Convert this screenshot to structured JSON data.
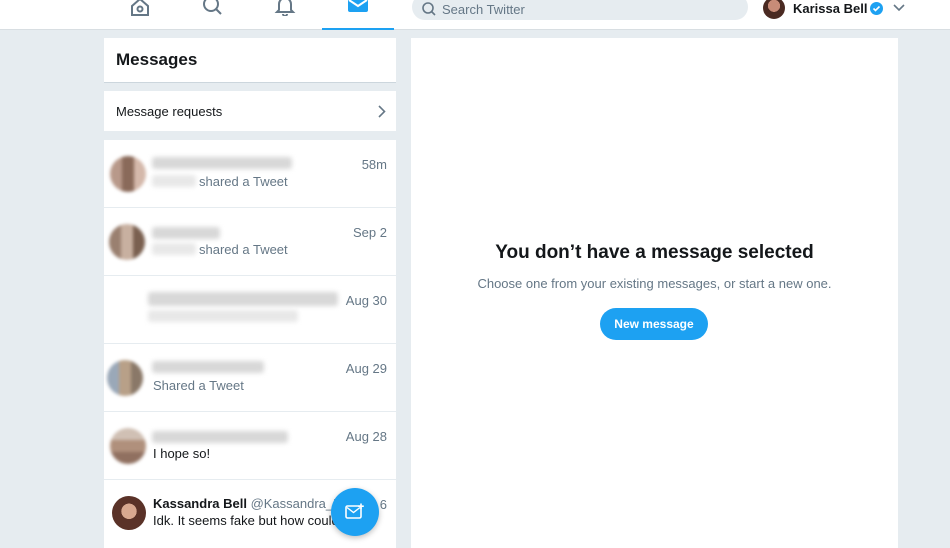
{
  "nav": {
    "icons": [
      "home-icon",
      "search-icon",
      "notifications-icon",
      "messages-icon"
    ],
    "active": "messages-icon",
    "search_placeholder": "Search Twitter"
  },
  "user": {
    "name": "Karissa Bell",
    "verified": true
  },
  "messages": {
    "title": "Messages",
    "requests_label": "Message requests",
    "conversations": [
      {
        "snippet": "shared a Tweet",
        "time": "58m"
      },
      {
        "snippet": "shared a Tweet",
        "time": "Sep 2"
      },
      {
        "snippet": "",
        "time": "Aug 30"
      },
      {
        "snippet": "Shared a Tweet",
        "time": "Aug 29"
      },
      {
        "snippet": "I hope so!",
        "time": "Aug 28"
      },
      {
        "name": "Kassandra Bell",
        "handle": "@Kassandra_Be",
        "snippet": "Idk. It seems fake but how could",
        "time": "6"
      }
    ]
  },
  "detail": {
    "title": "You don’t have a message selected",
    "subtitle": "Choose one from your existing messages, or start a new one.",
    "button_label": "New message"
  },
  "colors": {
    "accent": "#1da1f2",
    "background": "#e6ecf0"
  }
}
